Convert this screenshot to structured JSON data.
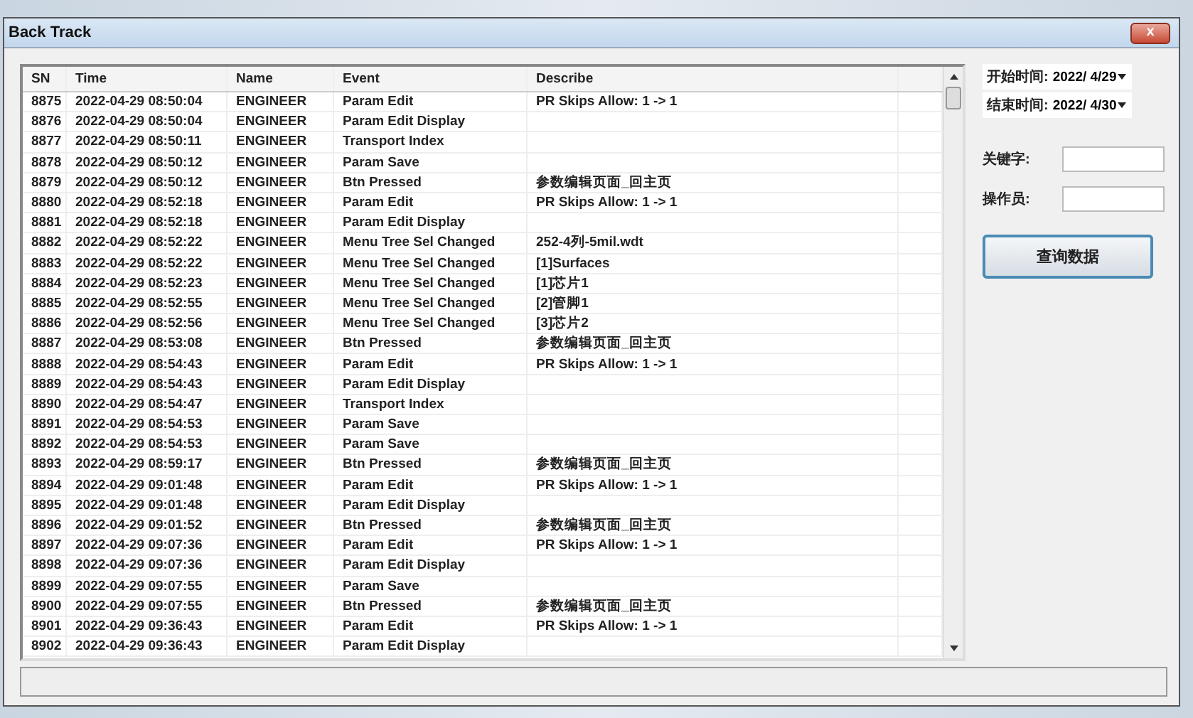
{
  "window": {
    "title": "Back Track",
    "close": "x"
  },
  "table": {
    "columns": [
      "SN",
      "Time",
      "Name",
      "Event",
      "Describe"
    ],
    "rows": [
      {
        "sn": "8875",
        "time": "2022-04-29 08:50:04",
        "name": "ENGINEER",
        "event": "Param Edit",
        "describe": "PR Skips Allow: 1 -> 1"
      },
      {
        "sn": "8876",
        "time": "2022-04-29 08:50:04",
        "name": "ENGINEER",
        "event": "Param Edit Display",
        "describe": ""
      },
      {
        "sn": "8877",
        "time": "2022-04-29 08:50:11",
        "name": "ENGINEER",
        "event": "Transport Index",
        "describe": ""
      },
      {
        "sn": "8878",
        "time": "2022-04-29 08:50:12",
        "name": "ENGINEER",
        "event": "Param Save",
        "describe": ""
      },
      {
        "sn": "8879",
        "time": "2022-04-29 08:50:12",
        "name": "ENGINEER",
        "event": "Btn Pressed",
        "describe": "参数编辑页面_回主页"
      },
      {
        "sn": "8880",
        "time": "2022-04-29 08:52:18",
        "name": "ENGINEER",
        "event": "Param Edit",
        "describe": "PR Skips Allow: 1 -> 1"
      },
      {
        "sn": "8881",
        "time": "2022-04-29 08:52:18",
        "name": "ENGINEER",
        "event": "Param Edit Display",
        "describe": ""
      },
      {
        "sn": "8882",
        "time": "2022-04-29 08:52:22",
        "name": "ENGINEER",
        "event": "Menu Tree Sel Changed",
        "describe": "252-4列-5mil.wdt"
      },
      {
        "sn": "8883",
        "time": "2022-04-29 08:52:22",
        "name": "ENGINEER",
        "event": "Menu Tree Sel Changed",
        "describe": "[1]Surfaces"
      },
      {
        "sn": "8884",
        "time": "2022-04-29 08:52:23",
        "name": "ENGINEER",
        "event": "Menu Tree Sel Changed",
        "describe": "[1]芯片1"
      },
      {
        "sn": "8885",
        "time": "2022-04-29 08:52:55",
        "name": "ENGINEER",
        "event": "Menu Tree Sel Changed",
        "describe": "[2]管脚1"
      },
      {
        "sn": "8886",
        "time": "2022-04-29 08:52:56",
        "name": "ENGINEER",
        "event": "Menu Tree Sel Changed",
        "describe": "[3]芯片2"
      },
      {
        "sn": "8887",
        "time": "2022-04-29 08:53:08",
        "name": "ENGINEER",
        "event": "Btn Pressed",
        "describe": "参数编辑页面_回主页"
      },
      {
        "sn": "8888",
        "time": "2022-04-29 08:54:43",
        "name": "ENGINEER",
        "event": "Param Edit",
        "describe": "PR Skips Allow: 1 -> 1"
      },
      {
        "sn": "8889",
        "time": "2022-04-29 08:54:43",
        "name": "ENGINEER",
        "event": "Param Edit Display",
        "describe": ""
      },
      {
        "sn": "8890",
        "time": "2022-04-29 08:54:47",
        "name": "ENGINEER",
        "event": "Transport Index",
        "describe": ""
      },
      {
        "sn": "8891",
        "time": "2022-04-29 08:54:53",
        "name": "ENGINEER",
        "event": "Param Save",
        "describe": ""
      },
      {
        "sn": "8892",
        "time": "2022-04-29 08:54:53",
        "name": "ENGINEER",
        "event": "Param Save",
        "describe": ""
      },
      {
        "sn": "8893",
        "time": "2022-04-29 08:59:17",
        "name": "ENGINEER",
        "event": "Btn Pressed",
        "describe": "参数编辑页面_回主页"
      },
      {
        "sn": "8894",
        "time": "2022-04-29 09:01:48",
        "name": "ENGINEER",
        "event": "Param Edit",
        "describe": "PR Skips Allow: 1 -> 1"
      },
      {
        "sn": "8895",
        "time": "2022-04-29 09:01:48",
        "name": "ENGINEER",
        "event": "Param Edit Display",
        "describe": ""
      },
      {
        "sn": "8896",
        "time": "2022-04-29 09:01:52",
        "name": "ENGINEER",
        "event": "Btn Pressed",
        "describe": "参数编辑页面_回主页"
      },
      {
        "sn": "8897",
        "time": "2022-04-29 09:07:36",
        "name": "ENGINEER",
        "event": "Param Edit",
        "describe": "PR Skips Allow: 1 -> 1"
      },
      {
        "sn": "8898",
        "time": "2022-04-29 09:07:36",
        "name": "ENGINEER",
        "event": "Param Edit Display",
        "describe": ""
      },
      {
        "sn": "8899",
        "time": "2022-04-29 09:07:55",
        "name": "ENGINEER",
        "event": "Param Save",
        "describe": ""
      },
      {
        "sn": "8900",
        "time": "2022-04-29 09:07:55",
        "name": "ENGINEER",
        "event": "Btn Pressed",
        "describe": "参数编辑页面_回主页"
      },
      {
        "sn": "8901",
        "time": "2022-04-29 09:36:43",
        "name": "ENGINEER",
        "event": "Param Edit",
        "describe": "PR Skips Allow: 1 -> 1"
      },
      {
        "sn": "8902",
        "time": "2022-04-29 09:36:43",
        "name": "ENGINEER",
        "event": "Param Edit Display",
        "describe": ""
      }
    ]
  },
  "filters": [
    {
      "kind": "date",
      "label": "开始时间:",
      "value": "2022/  4/29"
    },
    {
      "kind": "date",
      "label": "结束时间:",
      "value": "2022/  4/30"
    },
    {
      "kind": "text",
      "label": "关键字:"
    },
    {
      "kind": "text",
      "label": "操作员:"
    }
  ],
  "query_button": "查询数据"
}
